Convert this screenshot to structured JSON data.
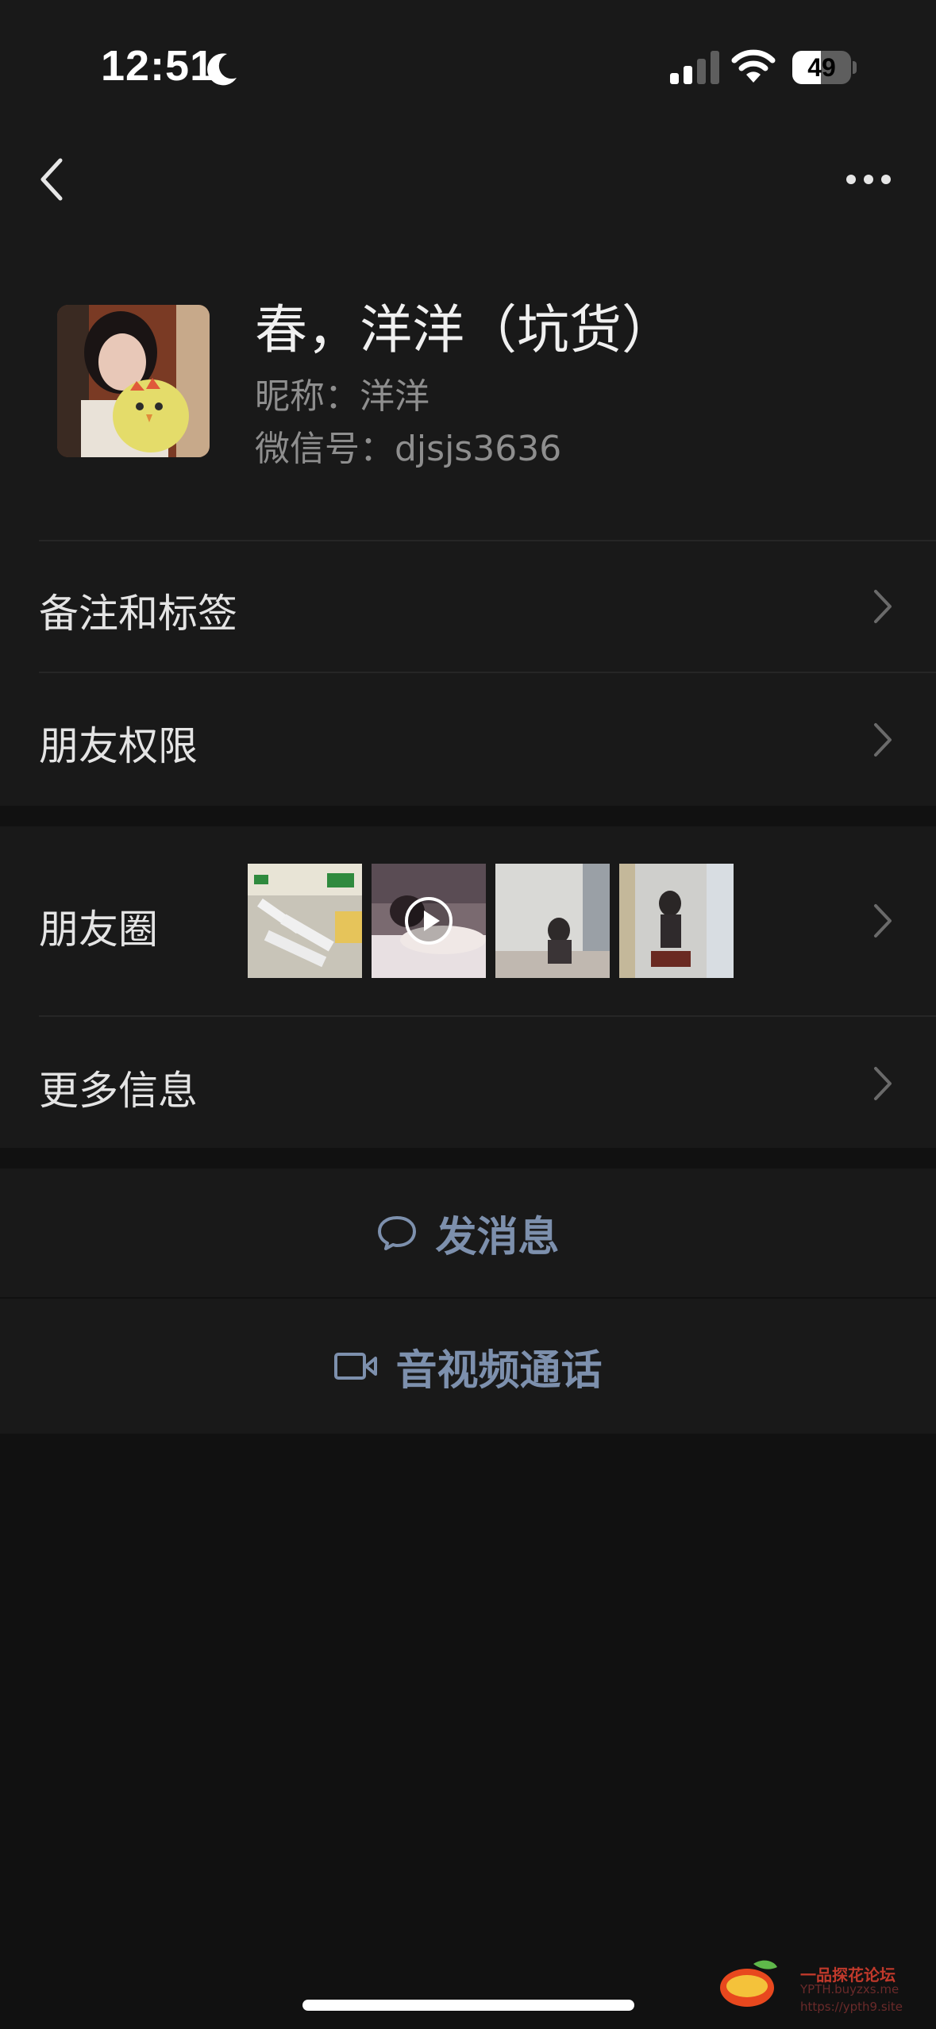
{
  "status_bar": {
    "time": "12:51",
    "battery_level": "49"
  },
  "profile": {
    "display_name": "春，洋洋（坑货）",
    "nickname_line": "昵称：洋洋",
    "wechat_id_line": "微信号：djsjs3636"
  },
  "menu": {
    "notes_tags": "备注和标签",
    "friend_permissions": "朋友权限",
    "moments": "朋友圈",
    "more_info": "更多信息"
  },
  "actions": {
    "send_message": "发消息",
    "av_call": "音视频通话"
  },
  "watermark": {
    "title": "一品探花论坛",
    "line1": "YPTH.buyzxs.me",
    "line2": "https://ypth9.site"
  },
  "colors": {
    "background": "#111111",
    "panel": "#191919",
    "action_text": "#7d90ad",
    "secondary_text": "#8e8e8e"
  },
  "icons": [
    "back-icon",
    "more-icon",
    "chevron-right-icon",
    "chat-bubble-icon",
    "video-camera-icon",
    "play-icon",
    "moon-icon",
    "signal-icon",
    "wifi-icon"
  ]
}
